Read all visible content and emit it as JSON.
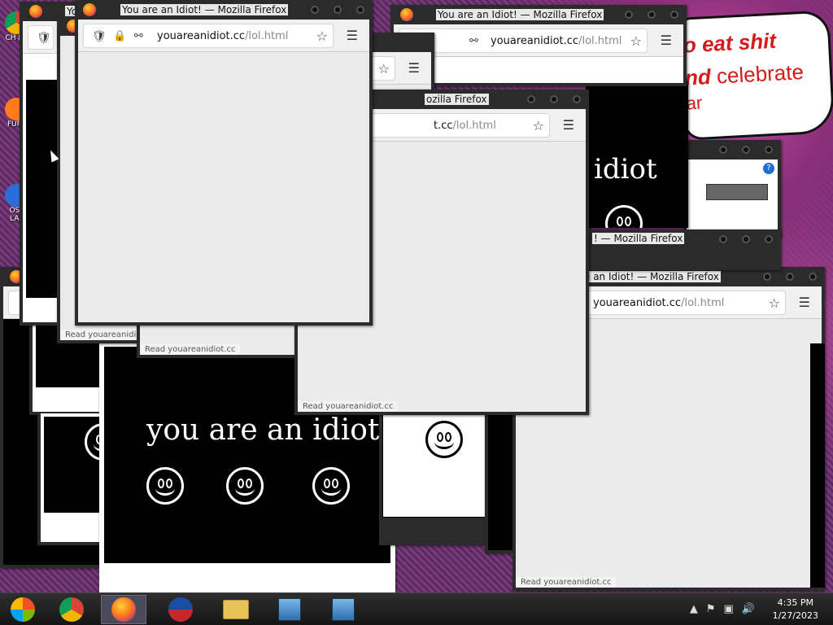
{
  "window_title": "You are an Idiot! — Mozilla Firefox",
  "title_partial_1": "! — Mozilla Firefox",
  "title_partial_2": "e an Idiot! — Mozilla Firefox",
  "title_partial_3": "ozilla Firefox",
  "title_partial_4": "Yo",
  "url_host": "youareanidiot.cc",
  "url_path": "/lol.html",
  "url_host_partial": "t.cc",
  "status_text": "Read youareanidiot.cc",
  "page_text": "you are an idiot",
  "page_text_partial": "idiot",
  "meme": {
    "line1": "o eat shit",
    "line2_bold": "nd",
    "line2_rest": " celebrate",
    "line3": "ar"
  },
  "desktop_icons": [
    {
      "label": "CH\nD"
    },
    {
      "label": "FUR"
    },
    {
      "label": "OS\nLA"
    }
  ],
  "clock": {
    "time": "4:35 PM",
    "date": "1/27/2023"
  },
  "colors": {
    "accent": "#ff7b1c",
    "meme_red": "#d51a1a"
  }
}
